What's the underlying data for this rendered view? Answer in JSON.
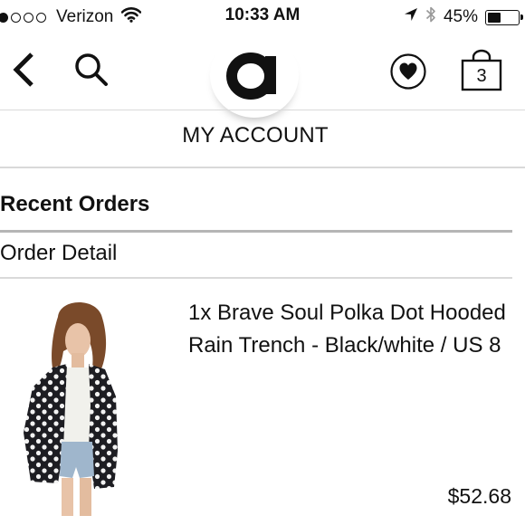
{
  "status_bar": {
    "carrier": "Verizon",
    "time": "10:33 AM",
    "battery_percent": "45%",
    "battery_level": 0.45,
    "signal_bars_filled": 1,
    "signal_bars_total": 5
  },
  "nav": {
    "back_icon": "chevron-left-icon",
    "search_icon": "search-icon",
    "logo_text": "a",
    "wishlist_icon": "heart-icon",
    "bag_count": "3"
  },
  "page": {
    "title": "MY ACCOUNT"
  },
  "orders": {
    "section_title": "Recent Orders",
    "subtitle": "Order Detail",
    "items": [
      {
        "name": "1x Brave Soul Polka Dot Hooded Rain Trench - Black/white / US 8",
        "price": "$52.68"
      }
    ]
  },
  "colors": {
    "text": "#111111",
    "divider": "#d9d9d9",
    "accent_divider": "#b5b5b5",
    "background": "#ffffff"
  }
}
